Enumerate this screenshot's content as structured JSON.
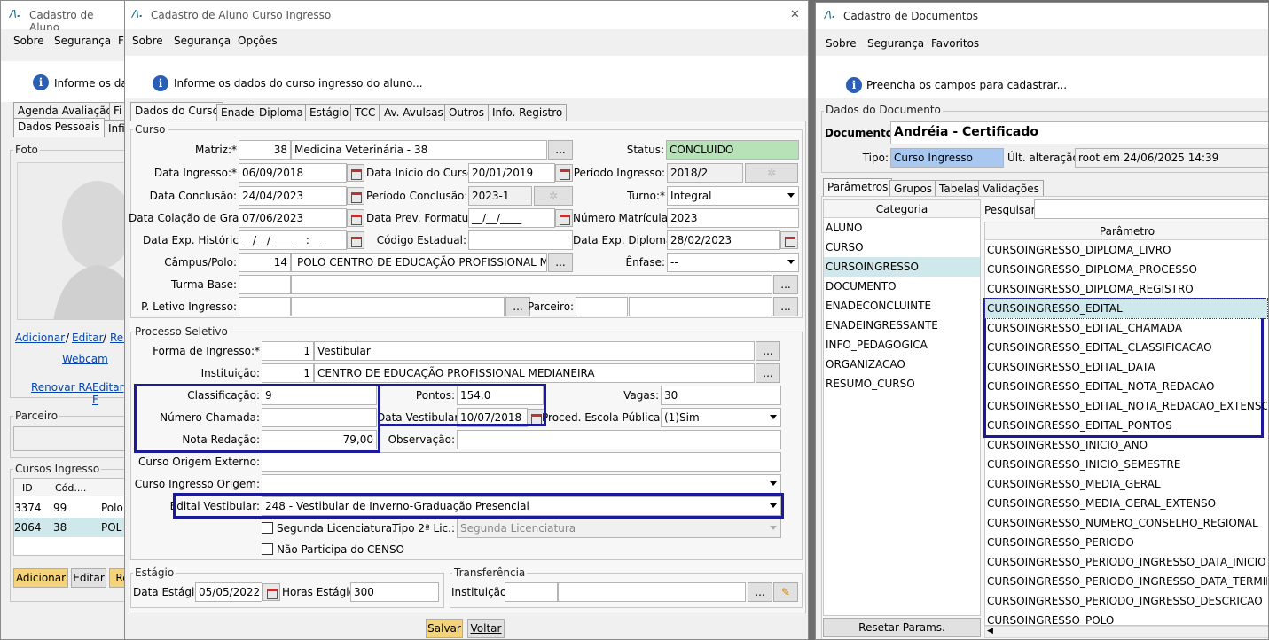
{
  "bg_win": {
    "title": "Cadastro de Aluno",
    "menu": [
      "Sobre",
      "Segurança",
      "F"
    ],
    "info": "Informe os dad",
    "tabs_row1": [
      "Agenda Avaliação",
      "Fi"
    ],
    "tabs_row2": [
      "Dados Pessoais",
      "Infi"
    ],
    "foto_label": "Foto",
    "links": {
      "adicionar": "Adicionar",
      "sep1": "/",
      "editar": "Editar",
      "sep2": "/",
      "rem": "Rem",
      "webcam": "Webcam",
      "renovar": "Renovar RA",
      "editar2": "Editar F"
    },
    "parceiro": "Parceiro",
    "cursos_ingresso": "Cursos Ingresso",
    "table_headers": [
      "ID",
      "Cód...."
    ],
    "rows": [
      [
        "3374",
        "99",
        "Polo"
      ],
      [
        "2064",
        "38",
        "POL"
      ]
    ],
    "buttons": [
      "Adicionar",
      "Editar",
      "Re"
    ]
  },
  "main": {
    "title": "Cadastro de Aluno Curso Ingresso",
    "close": "✕",
    "menu": [
      "Sobre",
      "Segurança",
      "Opções"
    ],
    "info": "Informe os dados do curso ingresso do aluno...",
    "tabs": [
      "Dados do Curso",
      "Enade",
      "Diploma",
      "Estágio",
      "TCC",
      "Av. Avulsas",
      "Outros",
      "Info. Registro"
    ],
    "curso": {
      "title": "Curso",
      "matriz_label": "Matriz:*",
      "matriz_code": "38",
      "matriz_name": "Medicina Veterinária - 38",
      "status_label": "Status:",
      "status": "CONCLUIDO",
      "data_ingresso_label": "Data Ingresso:*",
      "data_ingresso": "06/09/2018",
      "data_inicio_label": "Data Início do Curso:",
      "data_inicio": "20/01/2019",
      "periodo_ingresso_label": "Período Ingresso:",
      "periodo_ingresso": "2018/2",
      "data_conclusao_label": "Data Conclusão:",
      "data_conclusao": "24/04/2023",
      "periodo_conclusao_label": "Período Conclusão:",
      "periodo_conclusao": "2023-1",
      "turno_label": "Turno:*",
      "turno": "Integral",
      "data_colacao_label": "Data Colação de Grau:",
      "data_colacao": "07/06/2023",
      "data_prev_label": "Data Prev. Formatura:",
      "data_prev": "__/__/____",
      "numero_matricula_label": "Número Matrícula:",
      "numero_matricula": "2023",
      "data_exp_hist_label": "Data Exp. Histórico:",
      "data_exp_hist": "__/__/____ __:__",
      "codigo_estadual_label": "Código Estadual:",
      "codigo_estadual": "",
      "data_exp_diploma_label": "Data Exp. Diploma:",
      "data_exp_diploma": "28/02/2023",
      "campus_label": "Câmpus/Polo:",
      "campus_code": "14",
      "campus_name": "POLO CENTRO DE EDUCAÇÃO PROFISSIONAL MEDIA",
      "enfase_label": "Ênfase:",
      "enfase": "--",
      "turma_base_label": "Turma Base:",
      "p_letivo_label": "P. Letivo Ingresso:",
      "parceiro_label": "Parceiro:",
      "dots": "..."
    },
    "processo": {
      "title": "Processo Seletivo",
      "forma_label": "Forma de Ingresso:*",
      "forma_code": "1",
      "forma_name": "Vestibular",
      "instituicao_label": "Instituição:",
      "inst_code": "1",
      "inst_name": "CENTRO DE EDUCAÇÃO PROFISSIONAL MEDIANEIRA",
      "classificacao_label": "Classificação:",
      "classificacao": "9",
      "pontos_label": "Pontos:",
      "pontos": "154.0",
      "vagas_label": "Vagas:",
      "vagas": "30",
      "numero_chamada_label": "Número Chamada:",
      "numero_chamada": "",
      "data_vestibular_label": "Data Vestibular:",
      "data_vestibular": "10/07/2018",
      "proced_label": "Proced. Escola Pública:*",
      "proced": "(1)Sim",
      "nota_redacao_label": "Nota Redação:",
      "nota_redacao": "79,00",
      "observacao_label": "Observação:",
      "observacao": "",
      "curso_origem_ext_label": "Curso Origem Externo:",
      "curso_ingresso_origem_label": "Curso Ingresso Origem:",
      "edital_label": "Edital Vestibular:",
      "edital": "248 - Vestibular de Inverno-Graduação Presencial",
      "segunda_lic": "Segunda Licenciatura.",
      "tipo2_label": "Tipo 2ª Lic.:",
      "tipo2": "Segunda Licenciatura",
      "nao_participa": "Não Participa do CENSO"
    },
    "estagio": {
      "title": "Estágio",
      "data_label": "Data Estágio:",
      "data": "05/05/2022",
      "horas_label": "Horas Estágio:",
      "horas": "300"
    },
    "transf": {
      "title": "Transferência",
      "inst_label": "Instituição:"
    },
    "salvar": "Salvar",
    "voltar": "Voltar"
  },
  "docs": {
    "title": "Cadastro de Documentos",
    "menu": [
      "Sobre",
      "Segurança",
      "Favoritos"
    ],
    "info": "Preencha os campos para cadastrar...",
    "group_title": "Dados do Documento",
    "documento_label": "Documento:",
    "documento": "Andréia - Certificado",
    "tipo_label": "Tipo:",
    "tipo": "Curso Ingresso",
    "ult_label": "Últ. alteração:",
    "ult": "root em 24/06/2025 14:39",
    "tabs": [
      "Parâmetros",
      "Grupos",
      "Tabelas",
      "Validações"
    ],
    "categoria_header": "Categoria",
    "categorias": [
      "ALUNO",
      "CURSO",
      "CURSOINGRESSO",
      "DOCUMENTO",
      "ENADECONCLUINTE",
      "ENADEINGRESSANTE",
      "INFO_PEDAGOGICA",
      "ORGANIZACAO",
      "RESUMO_CURSO"
    ],
    "pesquisar_label": "Pesquisar:",
    "parametro_header": "Parâmetro",
    "parametros": [
      "CURSOINGRESSO_DIPLOMA_LIVRO",
      "CURSOINGRESSO_DIPLOMA_PROCESSO",
      "CURSOINGRESSO_DIPLOMA_REGISTRO",
      "CURSOINGRESSO_EDITAL",
      "CURSOINGRESSO_EDITAL_CHAMADA",
      "CURSOINGRESSO_EDITAL_CLASSIFICACAO",
      "CURSOINGRESSO_EDITAL_DATA",
      "CURSOINGRESSO_EDITAL_NOTA_REDACAO",
      "CURSOINGRESSO_EDITAL_NOTA_REDACAO_EXTENSO",
      "CURSOINGRESSO_EDITAL_PONTOS",
      "CURSOINGRESSO_INICIO_ANO",
      "CURSOINGRESSO_INICIO_SEMESTRE",
      "CURSOINGRESSO_MEDIA_GERAL",
      "CURSOINGRESSO_MEDIA_GERAL_EXTENSO",
      "CURSOINGRESSO_NUMERO_CONSELHO_REGIONAL",
      "CURSOINGRESSO_PERIODO",
      "CURSOINGRESSO_PERIODO_INGRESSO_DATA_INICIO",
      "CURSOINGRESSO_PERIODO_INGRESSO_DATA_TERMINO",
      "CURSOINGRESSO_PERIODO_INGRESSO_DESCRICAO",
      "CURSOINGRESSO_POLO"
    ],
    "reset": "Resetar Params."
  },
  "colors": {
    "highlight_border": "#1a1a9a",
    "selected_row": "#cfe8ec",
    "status_green": "#b7e2b7",
    "tipo_blue": "#a8c8f0",
    "button_yellow": "#f5d37a"
  }
}
